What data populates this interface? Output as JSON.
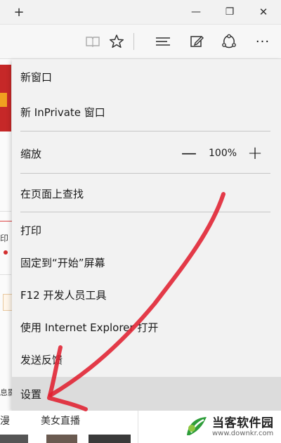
{
  "titlebar": {
    "new_tab_glyph": "+",
    "minimize_glyph": "—",
    "restore_glyph": "❐",
    "close_glyph": "✕"
  },
  "toolbar": {
    "icons": [
      "reading-view-icon",
      "favorite-star-icon",
      "hub-icon",
      "web-note-icon",
      "share-icon",
      "more-icon"
    ],
    "more_glyph": "···"
  },
  "menu": {
    "new_window": "新窗口",
    "new_inprivate": "新 InPrivate 窗口",
    "zoom_label": "缩放",
    "zoom_minus": "—",
    "zoom_value": "100%",
    "zoom_plus": "+",
    "find_on_page": "在页面上查找",
    "print": "打印",
    "pin_to_start": "固定到“开始”屏幕",
    "dev_tools": "F12 开发人员工具",
    "open_with_ie": "使用 Internet Explorer 打开",
    "send_feedback": "发送反馈",
    "settings": "设置"
  },
  "page": {
    "left_chars": [
      "印",
      "漫"
    ],
    "bottom_tab": "美女直播",
    "side_label": "息影"
  },
  "watermark": {
    "name": "当客软件园",
    "url": "www.downkr.com"
  },
  "colors": {
    "annotation": "#e02030",
    "menu_bg": "#f2f2f2",
    "hover_bg": "#dcdcdc",
    "logo_green": "#2e9d3a"
  }
}
